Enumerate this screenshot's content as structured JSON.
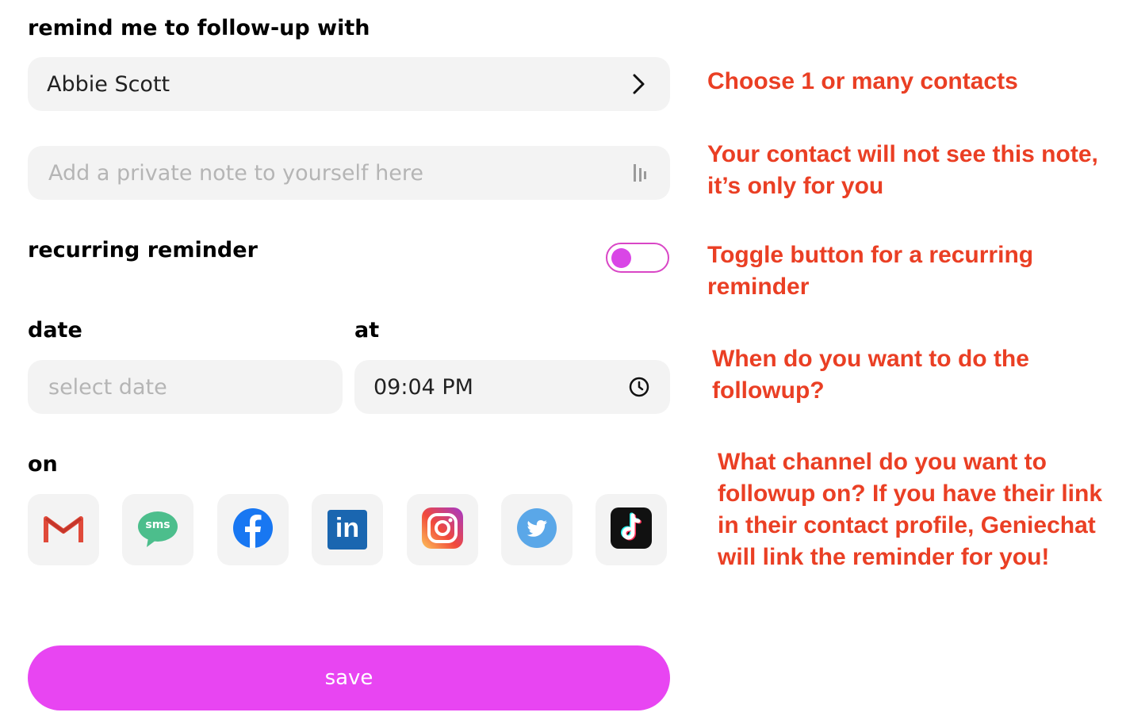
{
  "form": {
    "title": "remind me to follow-up with",
    "contact_value": "Abbie Scott",
    "note_placeholder": "Add a private note to yourself here",
    "recurring_label": "recurring reminder",
    "recurring_on": false,
    "date_label": "date",
    "date_placeholder": "select date",
    "at_label": "at",
    "time_value": "09:04 PM",
    "on_label": "on",
    "save_label": "save",
    "channel_icons": [
      "gmail-icon",
      "sms-icon",
      "facebook-icon",
      "linkedin-icon",
      "instagram-icon",
      "twitter-icon",
      "tiktok-icon"
    ],
    "sms_text": "sms",
    "linkedin_text": "in"
  },
  "annotations": {
    "contacts": "Choose 1 or many contacts",
    "note": "Your contact will not see this note, it’s only for you",
    "toggle": "Toggle button for a recurring reminder",
    "when": "When do you want to do the followup?",
    "channel": "What channel do you want to followup on? If you have their link in their contact profile, Geniechat will link the reminder for you!"
  },
  "colors": {
    "accent": "#e845f2",
    "annotation": "#ea3f24",
    "field_bg": "#f3f3f3"
  }
}
